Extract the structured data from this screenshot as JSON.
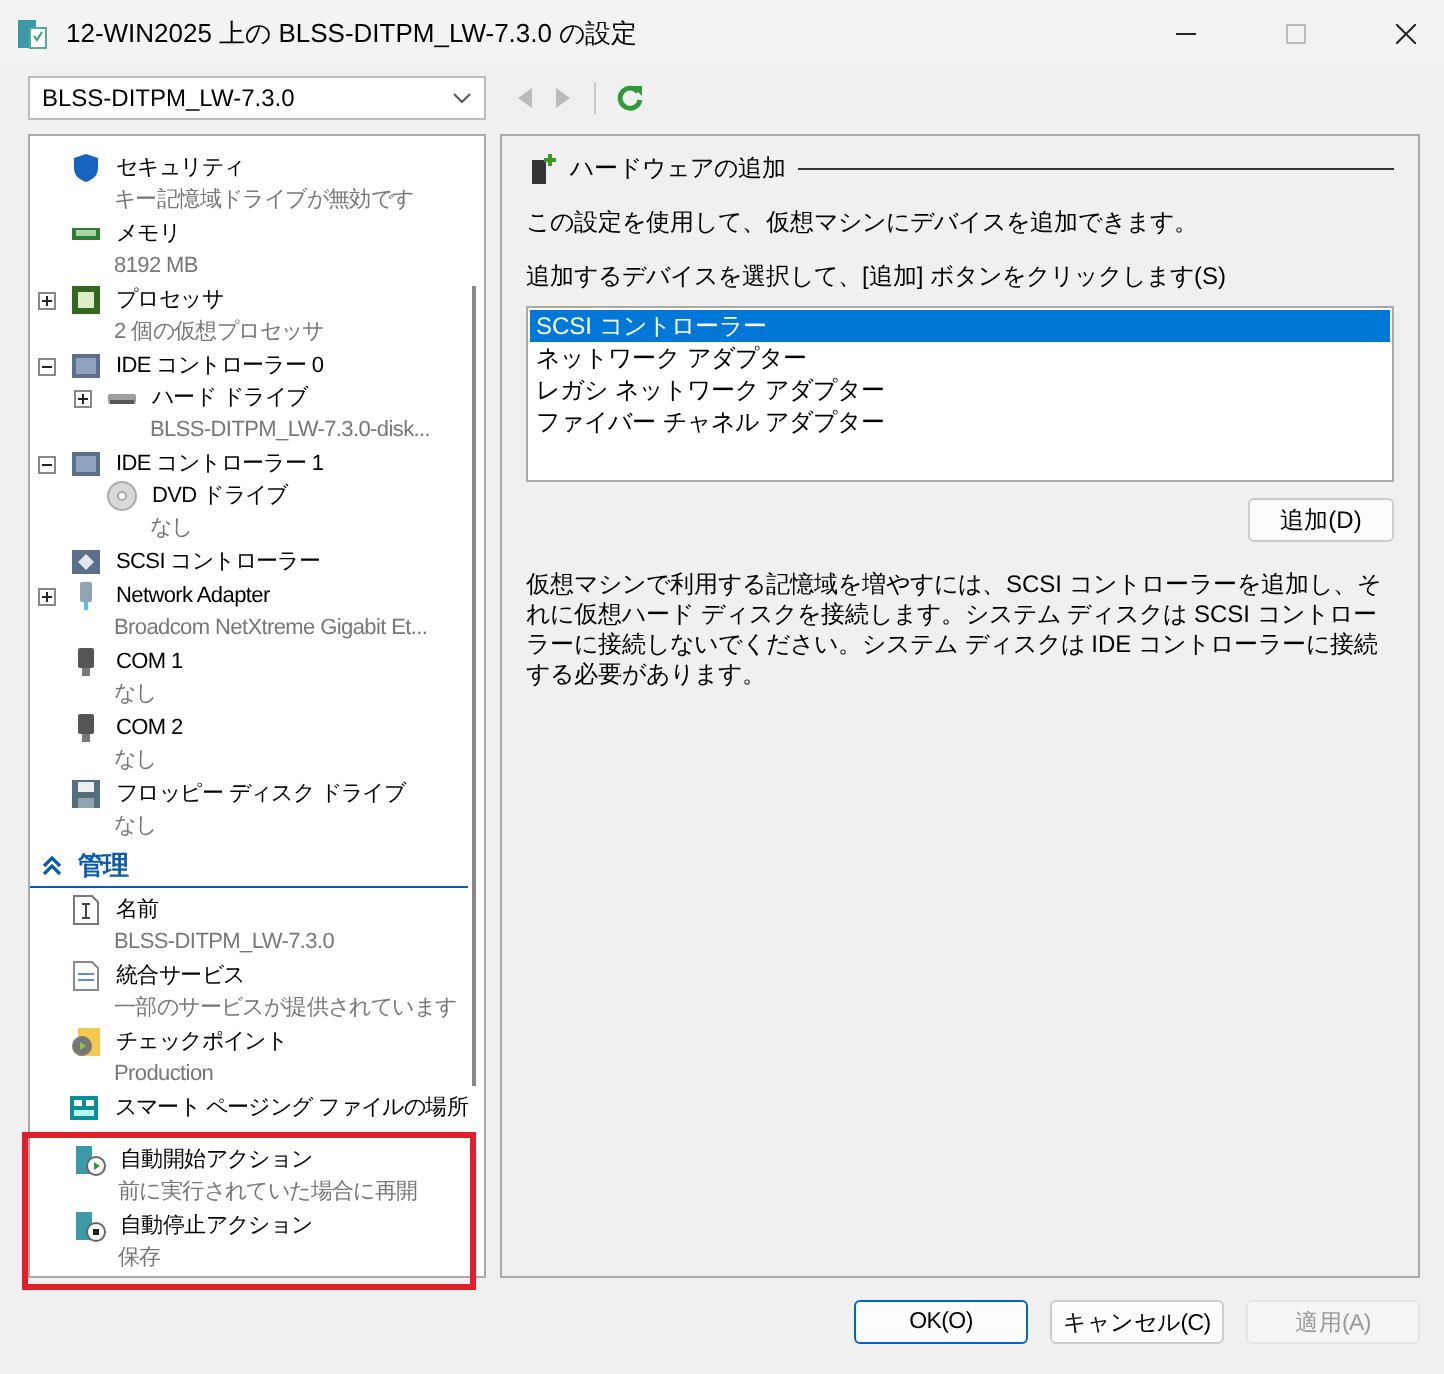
{
  "window": {
    "title": "12-WIN2025 上の BLSS-DITPM_LW-7.3.0 の設定"
  },
  "vm_select": {
    "value": "BLSS-DITPM_LW-7.3.0"
  },
  "sidebar": {
    "hardware": [
      {
        "label": "セキュリティ",
        "detail": "キー記憶域ドライブが無効です",
        "kind": "shield"
      },
      {
        "label": "メモリ",
        "detail": "8192 MB",
        "kind": "memory"
      },
      {
        "label": "プロセッサ",
        "detail": "2 個の仮想プロセッサ",
        "kind": "cpu",
        "expanded": false
      },
      {
        "label": "IDE コントローラー 0",
        "kind": "controller",
        "expanded": true,
        "children": [
          {
            "label": "ハード ドライブ",
            "detail": "BLSS-DITPM_LW-7.3.0-disk...",
            "kind": "disk",
            "expanded": false
          }
        ]
      },
      {
        "label": "IDE コントローラー 1",
        "kind": "controller",
        "expanded": true,
        "children": [
          {
            "label": "DVD ドライブ",
            "detail": "なし",
            "kind": "dvd"
          }
        ]
      },
      {
        "label": "SCSI コントローラー",
        "kind": "scsi"
      },
      {
        "label": "Network Adapter",
        "detail": "Broadcom NetXtreme Gigabit Et...",
        "kind": "network",
        "expanded": false
      },
      {
        "label": "COM 1",
        "detail": "なし",
        "kind": "com"
      },
      {
        "label": "COM 2",
        "detail": "なし",
        "kind": "com"
      },
      {
        "label": "フロッピー ディスク ドライブ",
        "detail": "なし",
        "kind": "floppy"
      }
    ],
    "management_header": "管理",
    "management": [
      {
        "label": "名前",
        "detail": "BLSS-DITPM_LW-7.3.0",
        "kind": "name",
        "highlighted": false
      },
      {
        "label": "統合サービス",
        "detail": "一部のサービスが提供されています",
        "kind": "services",
        "highlighted": false
      },
      {
        "label": "チェックポイント",
        "detail": "Production",
        "kind": "checkpoint",
        "highlighted": false
      },
      {
        "label": "スマート ページング ファイルの場所",
        "kind": "paging",
        "highlighted": false
      },
      {
        "label": "自動開始アクション",
        "detail": "前に実行されていた場合に再開",
        "kind": "start",
        "highlighted": true
      },
      {
        "label": "自動停止アクション",
        "detail": "保存",
        "kind": "stop",
        "highlighted": true
      }
    ]
  },
  "panel": {
    "title": "ハードウェアの追加",
    "intro": "この設定を使用して、仮想マシンにデバイスを追加できます。",
    "prompt": "追加するデバイスを選択して、[追加] ボタンをクリックします(S)",
    "devices": [
      {
        "label": "SCSI コントローラー",
        "selected": true
      },
      {
        "label": "ネットワーク アダプター",
        "selected": false
      },
      {
        "label": "レガシ ネットワーク アダプター",
        "selected": false
      },
      {
        "label": "ファイバー チャネル アダプター",
        "selected": false
      }
    ],
    "add_button": "追加(D)",
    "note": "仮想マシンで利用する記憶域を増やすには、SCSI コントローラーを追加し、それに仮想ハード ディスクを接続します。システム ディスクは SCSI コントローラーに接続しないでください。システム ディスクは IDE コントローラーに接続する必要があります。"
  },
  "buttons": [
    {
      "label": "OK(O)",
      "kind": "default",
      "disabled": false
    },
    {
      "label": "キャンセル(C)",
      "kind": "normal",
      "disabled": false
    },
    {
      "label": "適用(A)",
      "kind": "normal",
      "disabled": true
    }
  ]
}
